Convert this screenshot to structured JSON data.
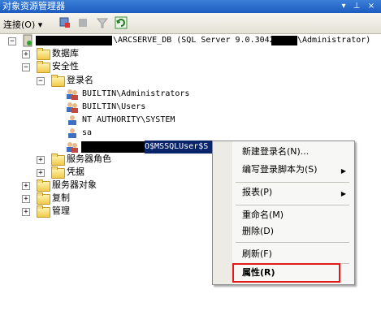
{
  "window": {
    "title": "对象资源管理器",
    "pin_glyph": "▾ ⊥ ×"
  },
  "toolbar": {
    "connect_label": "连接(O)",
    "connect_dropdown": "▾"
  },
  "tree": {
    "server_label": "\\ARCSERVE_DB (SQL Server 9.0.3042",
    "server_user": "\\Administrator)",
    "databases": "数据库",
    "security": "安全性",
    "logins": "登录名",
    "login_items": [
      "BUILTIN\\Administrators",
      "BUILTIN\\Users",
      "NT AUTHORITY\\SYSTEM",
      "sa",
      "O$MSSQLUser$S"
    ],
    "server_roles": "服务器角色",
    "credentials": "凭据",
    "server_objects": "服务器对象",
    "replication": "复制",
    "management": "管理"
  },
  "context_menu": {
    "items": [
      "新建登录名(N)...",
      "编写登录脚本为(S)",
      "报表(P)",
      "重命名(M)",
      "删除(D)",
      "刷新(F)",
      "属性(R)"
    ]
  }
}
